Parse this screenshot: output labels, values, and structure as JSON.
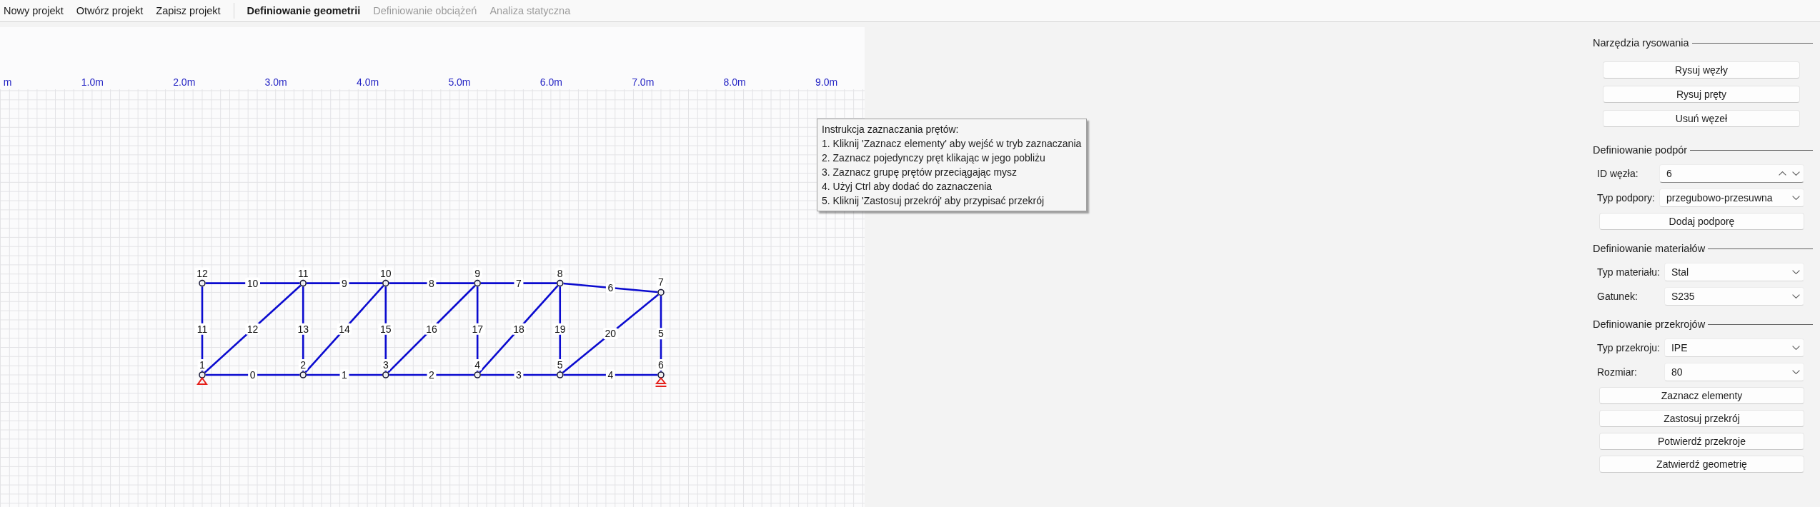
{
  "menu": {
    "actions": [
      "Nowy projekt",
      "Otwórz projekt",
      "Zapisz projekt"
    ],
    "steps": [
      {
        "label": "Definiowanie geometrii",
        "selected": true,
        "disabled": false
      },
      {
        "label": "Definiowanie obciążeń",
        "selected": false,
        "disabled": true
      },
      {
        "label": "Analiza statyczna",
        "selected": false,
        "disabled": true
      }
    ]
  },
  "canvas": {
    "ruler_labels": [
      "m",
      "1.0m",
      "2.0m",
      "3.0m",
      "4.0m",
      "5.0m",
      "6.0m",
      "7.0m",
      "8.0m",
      "9.0m"
    ],
    "nodes": [
      {
        "label": "12",
        "kind": "free"
      },
      {
        "label": "11",
        "kind": "free"
      },
      {
        "label": "10",
        "kind": "free"
      },
      {
        "label": "9",
        "kind": "free"
      },
      {
        "label": "8",
        "kind": "free"
      },
      {
        "label": "7",
        "kind": "free"
      },
      {
        "label": "1",
        "kind": "pinned"
      },
      {
        "label": "2",
        "kind": "free"
      },
      {
        "label": "3",
        "kind": "free"
      },
      {
        "label": "4",
        "kind": "free"
      },
      {
        "label": "5",
        "kind": "free"
      },
      {
        "label": "6",
        "kind": "roller"
      }
    ],
    "members": [
      {
        "label": "10"
      },
      {
        "label": "9"
      },
      {
        "label": "8"
      },
      {
        "label": "7"
      },
      {
        "label": "6"
      },
      {
        "label": "11"
      },
      {
        "label": "12"
      },
      {
        "label": "13"
      },
      {
        "label": "14"
      },
      {
        "label": "15"
      },
      {
        "label": "16"
      },
      {
        "label": "17"
      },
      {
        "label": "18"
      },
      {
        "label": "19"
      },
      {
        "label": "20"
      },
      {
        "label": "5"
      },
      {
        "label": "0"
      },
      {
        "label": "1"
      },
      {
        "label": "2"
      },
      {
        "label": "3"
      },
      {
        "label": "4"
      }
    ]
  },
  "tooltip": {
    "title": "Instrukcja zaznaczania prętów:",
    "lines": [
      "1. Kliknij 'Zaznacz elementy' aby wejść w tryb zaznaczania",
      "2. Zaznacz pojedynczy pręt klikając w jego pobliżu",
      "3. Zaznacz grupę prętów przeciągając mysz",
      "4. Użyj Ctrl aby dodać do zaznaczenia",
      "5. Kliknij 'Zastosuj przekrój' aby przypisać przekrój"
    ]
  },
  "panel": {
    "sections": [
      {
        "title": "Narzędzia rysowania",
        "items": [
          {
            "kind": "button",
            "label": "Rysuj węzły"
          },
          {
            "kind": "button",
            "label": "Rysuj pręty"
          },
          {
            "kind": "button",
            "label": "Usuń węzeł"
          }
        ]
      },
      {
        "title": "Definiowanie podpór",
        "items": [
          {
            "kind": "spinbox",
            "label": "ID węzła:",
            "value": "6"
          },
          {
            "kind": "combo",
            "label": "Typ podpory:",
            "value": "przegubowo-przesuwna"
          },
          {
            "kind": "button",
            "label": "Dodaj podporę"
          }
        ]
      },
      {
        "title": "Definiowanie materiałów",
        "items": [
          {
            "kind": "combo",
            "label": "Typ materiału:",
            "value": "Stal"
          },
          {
            "kind": "combo",
            "label": "Gatunek:",
            "value": "S235"
          }
        ]
      },
      {
        "title": "Definiowanie przekrojów",
        "items": [
          {
            "kind": "combo",
            "label": "Typ przekroju:",
            "value": "IPE"
          },
          {
            "kind": "combo",
            "label": "Rozmiar:",
            "value": "80"
          },
          {
            "kind": "button",
            "label": "Zaznacz elementy"
          },
          {
            "kind": "button",
            "label": "Zastosuj przekrój"
          },
          {
            "kind": "button",
            "label": "Potwierdź przekroje"
          },
          {
            "kind": "button",
            "label": "Zatwierdź geometrię"
          }
        ]
      }
    ]
  }
}
